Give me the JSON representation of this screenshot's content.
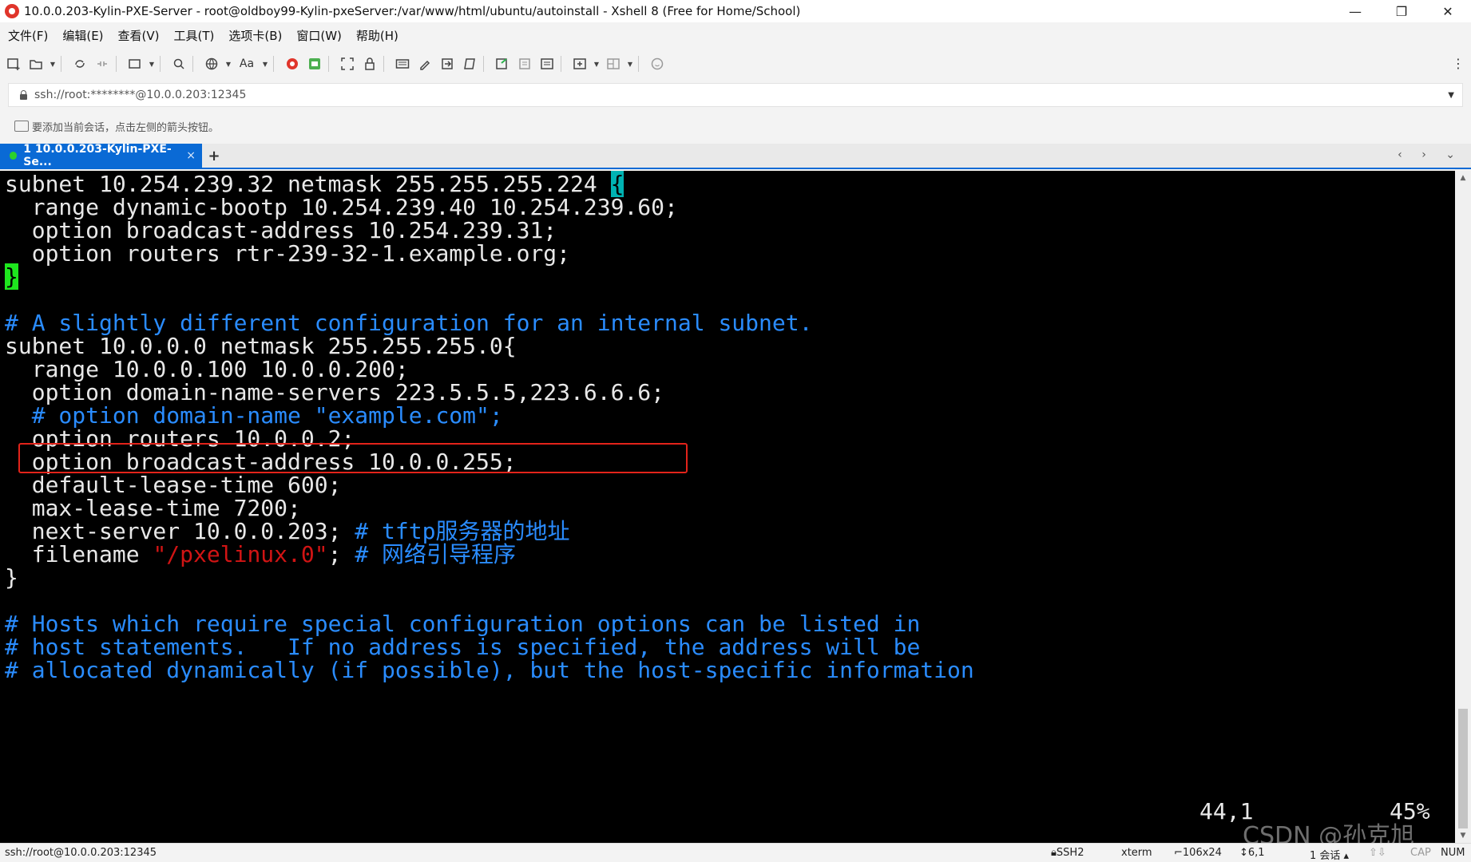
{
  "window": {
    "title": "10.0.0.203-Kylin-PXE-Server - root@oldboy99-Kylin-pxeServer:/var/www/html/ubuntu/autoinstall - Xshell 8 (Free for Home/School)",
    "minimize": "—",
    "restore": "❐",
    "close": "✕"
  },
  "menu": {
    "items": [
      "文件(F)",
      "编辑(E)",
      "查看(V)",
      "工具(T)",
      "选项卡(B)",
      "窗口(W)",
      "帮助(H)"
    ]
  },
  "toolbar": {
    "icons": [
      "new-session-icon",
      "open-folder-icon",
      "reconnect-icon",
      "disconnect-icon",
      "new-tab-icon",
      "find-icon",
      "globe-icon",
      "font-icon",
      "xftp-icon",
      "xagent-icon",
      "fullscreen-icon",
      "lock-icon",
      "keyboard-icon",
      "highlight-icon",
      "transfer-icon",
      "script-icon",
      "compose-icon",
      "log-icon",
      "script-list-icon",
      "add-icon",
      "layout-icon",
      "help-icon"
    ],
    "font_label": "Aa",
    "more": "⋮"
  },
  "address": {
    "value": "ssh://root:********@10.0.0.203:12345"
  },
  "hint": {
    "text": "要添加当前会话，点击左侧的箭头按钮。"
  },
  "tabs": {
    "active_label": "1 10.0.0.203-Kylin-PXE-Se...",
    "close": "×",
    "add": "+",
    "nav": "‹ › ⌄"
  },
  "terminal": {
    "lines": {
      "l1a": "subnet 10.254.239.32 netmask 255.255.255.224 ",
      "l1b": "{",
      "l2": "  range dynamic-bootp 10.254.239.40 10.254.239.60;",
      "l3": "  option broadcast-address 10.254.239.31;",
      "l4": "  option routers rtr-239-32-1.example.org;",
      "l5": "}",
      "l7": "# A slightly different configuration for an internal subnet.",
      "l8": "subnet 10.0.0.0 netmask 255.255.255.0{",
      "l9": "  range 10.0.0.100 10.0.0.200;",
      "l10": "  option domain-name-servers 223.5.5.5,223.6.6.6;",
      "l11": "  # option domain-name \"example.com\";",
      "l12": "  option routers 10.0.0.2;",
      "l13": "  option broadcast-address 10.0.0.255;",
      "l14": "  default-lease-time 600;",
      "l15": "  max-lease-time 7200;",
      "l16a": "  next-server 10.0.0.203; ",
      "l16b": "# tftp服务器的地址",
      "l17a": "  filename ",
      "l17b": "\"/pxelinux.0\"",
      "l17c": "; ",
      "l17d": "# 网络引导程序",
      "l18": "}",
      "l20": "# Hosts which require special configuration options can be listed in",
      "l21": "# host statements.   If no address is specified, the address will be",
      "l22": "# allocated dynamically (if possible), but the host-specific information"
    },
    "cursor_pos": "44,1",
    "percent": "45%",
    "scroll_fraction": 0.45,
    "watermark": "CSDN @孙克旭"
  },
  "status": {
    "connection": "ssh://root@10.0.0.203:12345",
    "protocol": "SSH2",
    "term": "xterm",
    "size": "106x24",
    "cursor": "6,1",
    "sessions": "1 会话",
    "cap": "CAP",
    "num": "NUM"
  },
  "colors": {
    "tab_active": "#0a6ad5",
    "comment": "#2a8cff",
    "string": "#d11414",
    "highlight_box": "#e2231a",
    "bracket_match": "#00b3b3",
    "cursor_block": "#1ee61e"
  }
}
